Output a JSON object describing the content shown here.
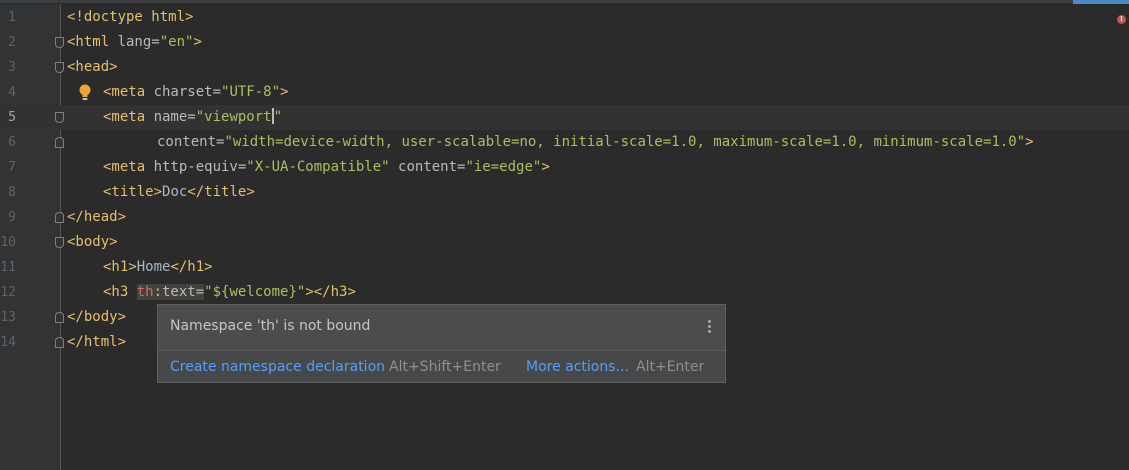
{
  "editor": {
    "current_line": 5,
    "line_numbers": [
      "1",
      "2",
      "3",
      "4",
      "5",
      "6",
      "7",
      "8",
      "9",
      "10",
      "11",
      "12",
      "13",
      "14"
    ]
  },
  "code": {
    "l1": "<!doctype html>",
    "l2_open": "<html ",
    "l2_attr": "lang=",
    "l2_val": "\"en\"",
    "l2_close": ">",
    "l3": "<head>",
    "l4_open": "<meta ",
    "l4_attr": "charset=",
    "l4_val": "\"UTF-8\"",
    "l4_close": ">",
    "l5_open": "<meta ",
    "l5_attr": "name=",
    "l5_val_open": "\"viewport",
    "l5_val_close": "\"",
    "l6_attr": "content=",
    "l6_val": "\"width=device-width, user-scalable=no, initial-scale=1.0, maximum-scale=1.0, minimum-scale=1.0\"",
    "l6_close": ">",
    "l7_open": "<meta ",
    "l7_attr1": "http-equiv=",
    "l7_val1": "\"X-UA-Compatible\"",
    "l7_attr2": " content=",
    "l7_val2": "\"ie=edge\"",
    "l7_close": ">",
    "l8_open": "<title>",
    "l8_text": "Doc",
    "l8_close": "</title>",
    "l9": "</head>",
    "l10": "<body>",
    "l11_open": "<h1>",
    "l11_text": "Home",
    "l11_close": "</h1>",
    "l12_open": "<h3 ",
    "l12_ns": "th",
    "l12_attr": ":text=",
    "l12_val": "\"${welcome}\"",
    "l12_close": "></h3>",
    "l13": "</body>",
    "l14": "</html>"
  },
  "popup": {
    "message": "Namespace 'th' is not bound",
    "action_primary": "Create namespace declaration",
    "action_primary_shortcut": "Alt+Shift+Enter",
    "action_more": "More actions...",
    "action_more_shortcut": "Alt+Enter"
  },
  "icons": {
    "intention": "lightbulb-icon",
    "menu": "more-vertical-icon",
    "error": "error-stripe-icon"
  },
  "colors": {
    "background": "#2b2b2b",
    "tag": "#e8bf6a",
    "attribute": "#bababa",
    "value": "#a5c25c",
    "error_namespace": "#cc6f58",
    "link": "#589df6"
  }
}
